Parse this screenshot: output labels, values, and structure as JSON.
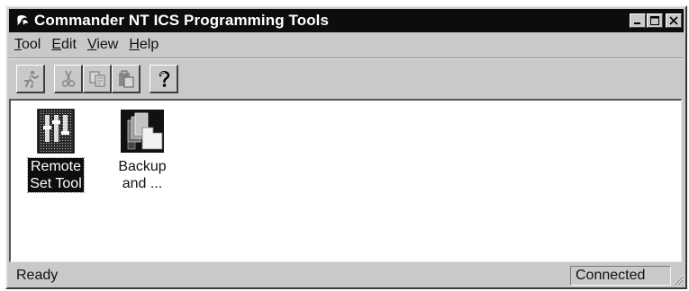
{
  "window": {
    "title": "Commander NT ICS Programming Tools",
    "controls": [
      "minimize",
      "maximize",
      "close"
    ]
  },
  "menu": {
    "items": [
      {
        "label": "Tool",
        "accel": "T",
        "rest": "ool"
      },
      {
        "label": "Edit",
        "accel": "E",
        "rest": "dit"
      },
      {
        "label": "View",
        "accel": "V",
        "rest": "iew"
      },
      {
        "label": "Help",
        "accel": "H",
        "rest": "elp"
      }
    ]
  },
  "toolbar": {
    "buttons": [
      {
        "icon": "run-icon",
        "enabled": false
      },
      {
        "icon": "cut-icon",
        "enabled": false
      },
      {
        "icon": "copy-icon",
        "enabled": false
      },
      {
        "icon": "paste-icon",
        "enabled": false
      },
      {
        "icon": "help-icon",
        "enabled": true
      }
    ]
  },
  "content": {
    "items": [
      {
        "line1": "Remote",
        "line2": "Set Tool",
        "icon": "remote-set-tool-icon",
        "selected": true
      },
      {
        "line1": "Backup",
        "line2": "and ...",
        "icon": "backup-icon",
        "selected": false
      }
    ]
  },
  "status": {
    "text": "Ready",
    "connection": "Connected"
  }
}
